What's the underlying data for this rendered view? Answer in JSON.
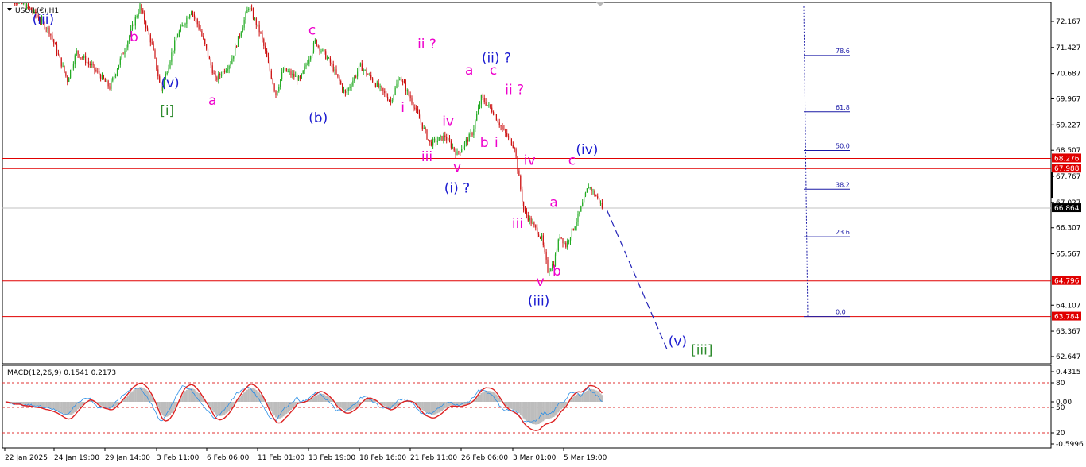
{
  "title": "USOIL(€),H1",
  "colors": {
    "bull": "#22aa22",
    "bear": "#cc1111",
    "hline": "#e00000",
    "fib": "#1a1aa6",
    "wave_blue": "#1a1ad0",
    "wave_magenta": "#ee00cc",
    "wave_green": "#2e8b2e",
    "macd_hist": "#bdbdbd",
    "macd_line": "#2a8fe6",
    "signal_line": "#dd2222"
  },
  "chart_data": [
    {
      "type": "candlestick",
      "symbol": "USOIL(€)",
      "timeframe": "H1",
      "x_labels": [
        "22 Jan 2025",
        "24 Jan 19:00",
        "29 Jan 14:00",
        "3 Feb 11:00",
        "6 Feb 06:00",
        "11 Feb 01:00",
        "13 Feb 19:00",
        "18 Feb 16:00",
        "21 Feb 11:00",
        "26 Feb 06:00",
        "3 Mar 01:00",
        "5 Mar 19:00"
      ],
      "y_ticks": [
        "72.167",
        "71.427",
        "70.687",
        "69.967",
        "69.227",
        "68.507",
        "67.767",
        "67.027",
        "66.307",
        "65.567",
        "64.107",
        "63.367",
        "62.647"
      ],
      "ylim": [
        62.647,
        72.6
      ],
      "price_path": [
        [
          0,
          73.0
        ],
        [
          18,
          72.5
        ],
        [
          30,
          71.9
        ],
        [
          42,
          70.5
        ],
        [
          48,
          71.3
        ],
        [
          58,
          70.9
        ],
        [
          70,
          70.3
        ],
        [
          80,
          71.4
        ],
        [
          90,
          72.6
        ],
        [
          98,
          71.5
        ],
        [
          104,
          70.2
        ],
        [
          114,
          71.7
        ],
        [
          124,
          72.5
        ],
        [
          130,
          71.9
        ],
        [
          140,
          70.5
        ],
        [
          150,
          71.0
        ],
        [
          162,
          72.6
        ],
        [
          170,
          71.8
        ],
        [
          180,
          70.1
        ],
        [
          185,
          70.8
        ],
        [
          196,
          70.5
        ],
        [
          206,
          71.6
        ],
        [
          216,
          71.0
        ],
        [
          226,
          70.1
        ],
        [
          236,
          70.9
        ],
        [
          246,
          70.4
        ],
        [
          256,
          69.9
        ],
        [
          262,
          70.6
        ],
        [
          270,
          69.9
        ],
        [
          282,
          68.7
        ],
        [
          292,
          68.9
        ],
        [
          300,
          68.4
        ],
        [
          310,
          69.0
        ],
        [
          316,
          70.0
        ],
        [
          324,
          69.6
        ],
        [
          330,
          69.1
        ],
        [
          338,
          68.6
        ],
        [
          344,
          66.8
        ],
        [
          350,
          66.4
        ],
        [
          356,
          66.0
        ],
        [
          360,
          65.1
        ],
        [
          364,
          65.3
        ],
        [
          368,
          66.1
        ],
        [
          372,
          65.8
        ],
        [
          380,
          66.6
        ],
        [
          387,
          67.5
        ],
        [
          392,
          67.2
        ],
        [
          396,
          66.9
        ]
      ],
      "horizontal_levels": [
        {
          "label": "68.276",
          "value": 68.276
        },
        {
          "label": "67.988",
          "value": 67.988
        },
        {
          "label": "64.796",
          "value": 64.796
        },
        {
          "label": "63.784",
          "value": 63.784
        }
      ],
      "current_price": {
        "label": "66.864",
        "value": 66.864
      },
      "fibonacci": [
        {
          "label": "78.6",
          "value": 71.2
        },
        {
          "label": "61.8",
          "value": 69.6
        },
        {
          "label": "50.0",
          "value": 68.5
        },
        {
          "label": "38.2",
          "value": 67.4
        },
        {
          "label": "23.6",
          "value": 66.05
        },
        {
          "label": "0.0",
          "value": 63.784
        }
      ],
      "projection": {
        "from": [
          396,
          66.9
        ],
        "to": [
          440,
          62.75
        ]
      },
      "wave_labels": [
        {
          "text": "(iii)",
          "at": [
            26,
            72.1
          ],
          "color": "wave_blue"
        },
        {
          "text": "b",
          "at": [
            86,
            71.6
          ],
          "color": "wave_magenta"
        },
        {
          "text": "(v)",
          "at": [
            110,
            70.3
          ],
          "color": "wave_blue"
        },
        {
          "text": "[i]",
          "at": [
            108,
            69.5
          ],
          "color": "wave_green"
        },
        {
          "text": "a",
          "at": [
            138,
            69.8
          ],
          "color": "wave_magenta"
        },
        {
          "text": "c",
          "at": [
            204,
            71.8
          ],
          "color": "wave_magenta"
        },
        {
          "text": "(b)",
          "at": [
            208,
            69.3
          ],
          "color": "wave_blue"
        },
        {
          "text": "i",
          "at": [
            264,
            69.6
          ],
          "color": "wave_magenta"
        },
        {
          "text": "ii ?",
          "at": [
            280,
            71.4
          ],
          "color": "wave_magenta"
        },
        {
          "text": "iii",
          "at": [
            280,
            68.2
          ],
          "color": "wave_magenta"
        },
        {
          "text": "iv",
          "at": [
            294,
            69.2
          ],
          "color": "wave_magenta"
        },
        {
          "text": "v",
          "at": [
            300,
            67.9
          ],
          "color": "wave_magenta"
        },
        {
          "text": "(i) ?",
          "at": [
            300,
            67.3
          ],
          "color": "wave_blue"
        },
        {
          "text": "a",
          "at": [
            308,
            70.65
          ],
          "color": "wave_magenta"
        },
        {
          "text": "(ii) ?",
          "at": [
            326,
            71.0
          ],
          "color": "wave_blue"
        },
        {
          "text": "c",
          "at": [
            324,
            70.65
          ],
          "color": "wave_magenta"
        },
        {
          "text": "ii ?",
          "at": [
            338,
            70.1
          ],
          "color": "wave_magenta"
        },
        {
          "text": "b",
          "at": [
            318,
            68.6
          ],
          "color": "wave_magenta"
        },
        {
          "text": "i",
          "at": [
            326,
            68.6
          ],
          "color": "wave_magenta"
        },
        {
          "text": "iv",
          "at": [
            348,
            68.1
          ],
          "color": "wave_magenta"
        },
        {
          "text": "iii",
          "at": [
            340,
            66.3
          ],
          "color": "wave_magenta"
        },
        {
          "text": "a",
          "at": [
            364,
            66.9
          ],
          "color": "wave_magenta"
        },
        {
          "text": "c",
          "at": [
            376,
            68.1
          ],
          "color": "wave_magenta"
        },
        {
          "text": "(iv)",
          "at": [
            386,
            68.4
          ],
          "color": "wave_blue"
        },
        {
          "text": "v",
          "at": [
            355,
            64.65
          ],
          "color": "wave_magenta"
        },
        {
          "text": "b",
          "at": [
            366,
            64.95
          ],
          "color": "wave_magenta"
        },
        {
          "text": "(iii)",
          "at": [
            354,
            64.1
          ],
          "color": "wave_blue"
        },
        {
          "text": "(v)",
          "at": [
            446,
            62.95
          ],
          "color": "wave_blue"
        },
        {
          "text": "[iii]",
          "at": [
            462,
            62.7
          ],
          "color": "wave_green"
        }
      ]
    },
    {
      "type": "macd",
      "title": "MACD(12,26,9) 0.1541 0.2173",
      "y_ticks": [
        "0.4315",
        "80",
        "50",
        "0.00",
        "20",
        "-0.5996"
      ],
      "ylim": [
        -0.5996,
        0.4315
      ]
    }
  ]
}
